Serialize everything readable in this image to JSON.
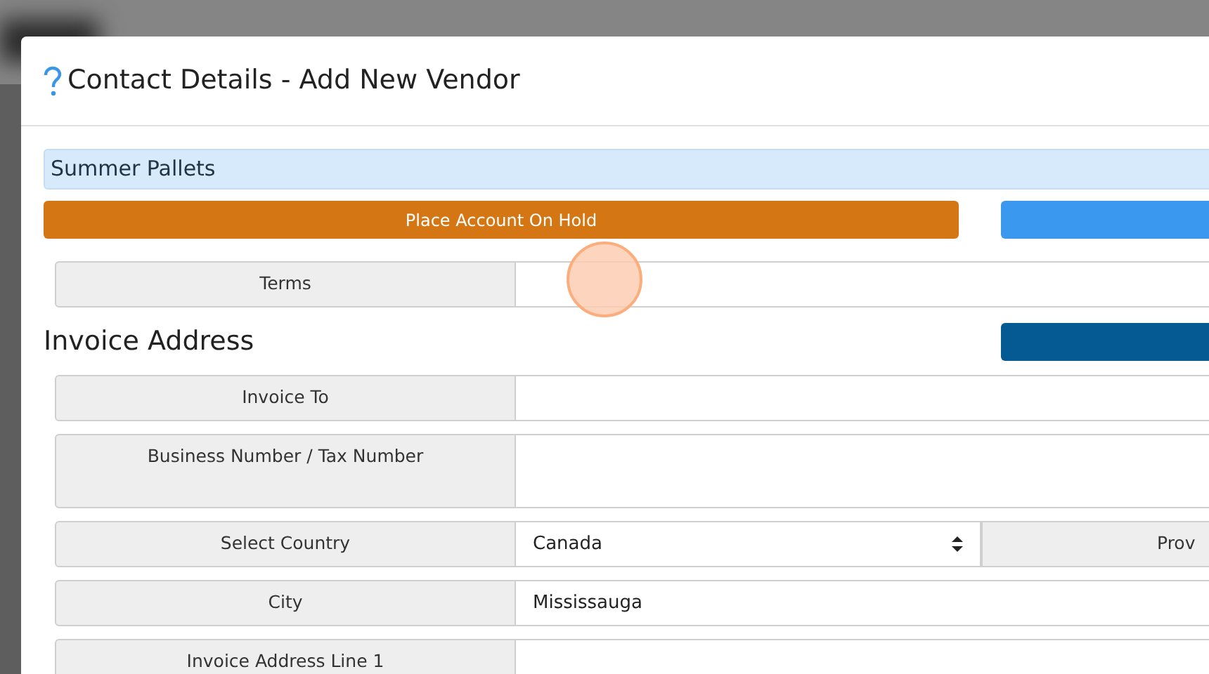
{
  "dialog": {
    "title": "Contact Details - Add New Vendor"
  },
  "vendor_banner": "Summer Pallets",
  "hold_button": {
    "label": "Place Account On Hold"
  },
  "terms_rows": [
    {
      "kind": "text",
      "label": "Terms",
      "value": ""
    }
  ],
  "invoice_section": {
    "heading": "Invoice Address"
  },
  "invoice_rows": [
    {
      "kind": "text",
      "label": "Invoice To",
      "value": ""
    },
    {
      "kind": "textarea",
      "label": "Business Number / Tax Number",
      "value": ""
    },
    {
      "kind": "select",
      "label": "Select Country",
      "value": "Canada",
      "side_label": "Prov"
    },
    {
      "kind": "text",
      "label": "City",
      "value": "Mississauga"
    },
    {
      "kind": "text",
      "label": "Invoice Address Line 1",
      "value": ""
    }
  ]
}
